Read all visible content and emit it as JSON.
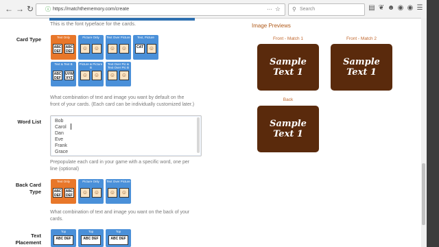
{
  "browser": {
    "url": "https://matchthememory.com/create",
    "search_placeholder": "Search",
    "url_more": "···"
  },
  "form": {
    "font_desc": "This is the font typeface for the cards.",
    "card_type_label": "Card Type",
    "card_type_tiles": [
      {
        "label": "Text Only",
        "selected": true,
        "c1": "ABC DEF",
        "c2": "ABC DEF",
        "pic1": false,
        "pic2": false
      },
      {
        "label": "Picture Only",
        "selected": false,
        "c1": "",
        "c2": "",
        "pic1": true,
        "pic2": true
      },
      {
        "label": "Text Over Picture",
        "selected": false,
        "c1": "",
        "c2": "",
        "pic1": true,
        "pic2": true
      },
      {
        "label": "Text, Picture",
        "selected": false,
        "c1": "CAT",
        "c2": "",
        "pic1": false,
        "pic2": true
      },
      {
        "label": "Text & Text B",
        "selected": false,
        "c1": "ABC DEF",
        "c2": "UVW XYZ",
        "pic1": false,
        "pic2": false
      },
      {
        "label": "Picture & Picture B",
        "selected": false,
        "c1": "",
        "c2": "",
        "pic1": true,
        "pic2": true
      },
      {
        "label": "Text Over Pic & Text Over Pic B",
        "selected": false,
        "c1": "",
        "c2": "",
        "pic1": true,
        "pic2": true
      }
    ],
    "card_type_desc_1": "What combination of text and image you want by default on the",
    "card_type_desc_2": "front of your cards. (Each card can be individually customized later.)",
    "word_list_label": "Word List",
    "word_list_lines": [
      "Bob",
      "Carol",
      "Dan",
      "Eve",
      "Frank",
      "Grace"
    ],
    "word_list_desc_1": "Prepopulate each card in your game with a specific word, one per",
    "word_list_desc_2": "line (optional)",
    "back_card_type_label_1": "Back Card",
    "back_card_type_label_2": "Type",
    "back_tiles": [
      {
        "label": "Text Only",
        "selected": true,
        "c1": "ABC DEF",
        "c2": "ABC DEF",
        "pic1": false,
        "pic2": false
      },
      {
        "label": "Picture Only",
        "selected": false,
        "c1": "",
        "c2": "",
        "pic1": true,
        "pic2": true
      },
      {
        "label": "Text Over Picture",
        "selected": false,
        "c1": "",
        "c2": "",
        "pic1": true,
        "pic2": true
      }
    ],
    "back_desc_1": "What combination of text and image you want on the back of your",
    "back_desc_2": "cards.",
    "text_placement_label_1": "Text",
    "text_placement_label_2": "Placement",
    "placement_tiles": [
      {
        "label": "Top",
        "c": "ABC DEF"
      },
      {
        "label": "Top",
        "c": "ABC DEF"
      },
      {
        "label": "Top",
        "c": "ABC DEF"
      }
    ]
  },
  "previews": {
    "title": "Image Previews",
    "front1_label": "Front - Match 1",
    "front2_label": "Front - Match 2",
    "back_label": "Back",
    "sample_line1": "Sample",
    "sample_line2": "Text 1",
    "card_color": "#5a2a0c"
  }
}
